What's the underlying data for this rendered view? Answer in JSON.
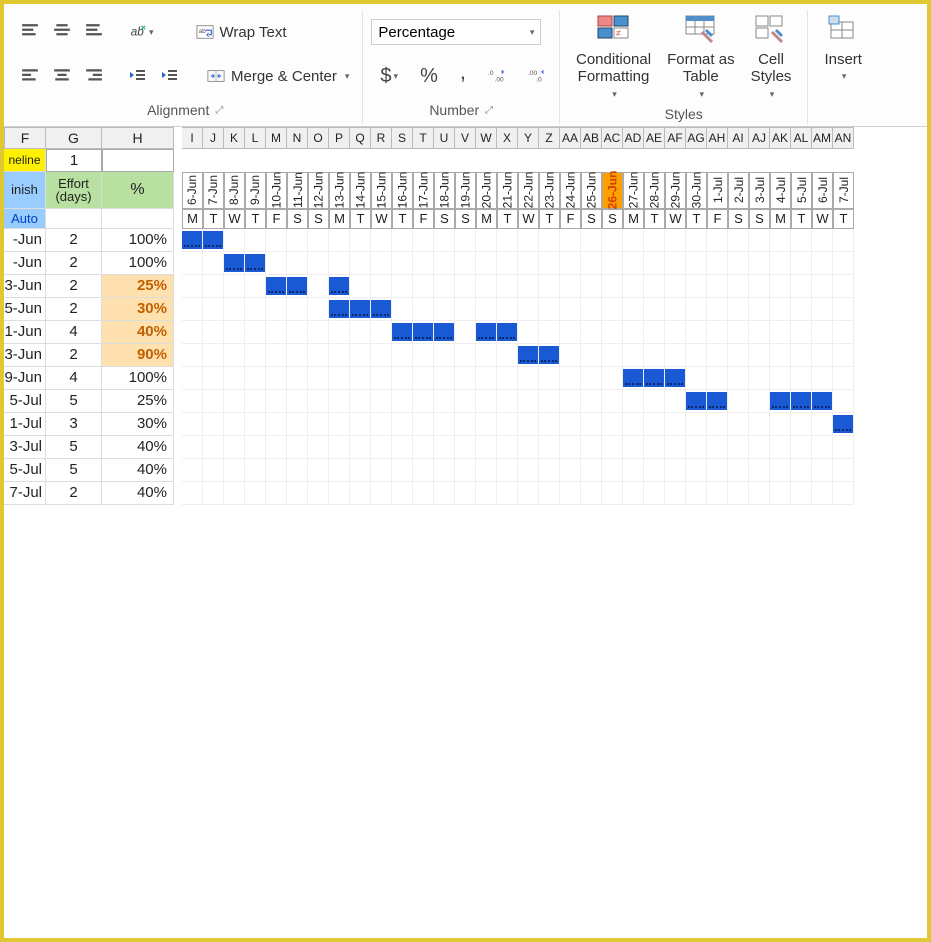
{
  "ribbon": {
    "wrap_text": "Wrap Text",
    "merge_center": "Merge & Center",
    "number_format": "Percentage",
    "cond_fmt": "Conditional\nFormatting",
    "fmt_table": "Format as\nTable",
    "cell_styles": "Cell\nStyles",
    "insert": "Insert",
    "grp_alignment": "Alignment",
    "grp_number": "Number",
    "grp_styles": "Styles"
  },
  "colheads_left": [
    "F",
    "G",
    "H"
  ],
  "colheads_narrow": [
    "I",
    "J",
    "K",
    "L",
    "M",
    "N",
    "O",
    "P",
    "Q",
    "R",
    "S",
    "T",
    "U",
    "V",
    "W",
    "X",
    "Y",
    "Z",
    "AA",
    "AB",
    "AC",
    "AD",
    "AE",
    "AF",
    "AG",
    "AH",
    "AI",
    "AJ",
    "AK",
    "AL",
    "AM",
    "AN"
  ],
  "dates": [
    "6-Jun",
    "7-Jun",
    "8-Jun",
    "9-Jun",
    "10-Jun",
    "11-Jun",
    "12-Jun",
    "13-Jun",
    "14-Jun",
    "15-Jun",
    "16-Jun",
    "17-Jun",
    "18-Jun",
    "19-Jun",
    "20-Jun",
    "21-Jun",
    "22-Jun",
    "23-Jun",
    "24-Jun",
    "25-Jun",
    "26-Jun",
    "27-Jun",
    "28-Jun",
    "29-Jun",
    "30-Jun",
    "1-Jul",
    "2-Jul",
    "3-Jul",
    "4-Jul",
    "5-Jul",
    "6-Jul",
    "7-Jul"
  ],
  "today_index": 20,
  "weekdays": [
    "M",
    "T",
    "W",
    "T",
    "F",
    "S",
    "S",
    "M",
    "T",
    "W",
    "T",
    "F",
    "S",
    "S",
    "M",
    "T",
    "W",
    "T",
    "F",
    "S",
    "S",
    "M",
    "T",
    "W",
    "T",
    "F",
    "S",
    "S",
    "M",
    "T",
    "W",
    "T"
  ],
  "hdr": {
    "timeline": "neline",
    "one": "1",
    "finish": "inish",
    "effort": "Effort (days)",
    "pct": "%",
    "auto": "Auto"
  },
  "rows": [
    {
      "f": "-Jun",
      "g": "2",
      "h": "100%",
      "h_orange": false,
      "bar_start": 0,
      "bar_len": 2
    },
    {
      "f": "-Jun",
      "g": "2",
      "h": "100%",
      "h_orange": false,
      "bar_start": 2,
      "bar_len": 2
    },
    {
      "f": "3-Jun",
      "g": "2",
      "h": "25%",
      "h_orange": true,
      "bar_start": 4,
      "bar_len": 2,
      "extra": [
        7
      ]
    },
    {
      "f": "5-Jun",
      "g": "2",
      "h": "30%",
      "h_orange": true,
      "bar_start": 7,
      "bar_len": 3
    },
    {
      "f": "1-Jun",
      "g": "4",
      "h": "40%",
      "h_orange": true,
      "bar_start": 10,
      "bar_len": 3,
      "extra": [
        14,
        15
      ]
    },
    {
      "f": "3-Jun",
      "g": "2",
      "h": "90%",
      "h_orange": true,
      "bar_start": 16,
      "bar_len": 2
    },
    {
      "f": "9-Jun",
      "g": "4",
      "h": "100%",
      "h_orange": false,
      "bar_start": 21,
      "bar_len": 3
    },
    {
      "f": "5-Jul",
      "g": "5",
      "h": "25%",
      "h_orange": false,
      "bar_start": 24,
      "bar_len": 2,
      "extra": [
        28,
        29,
        30
      ]
    },
    {
      "f": "1-Jul",
      "g": "3",
      "h": "30%",
      "h_orange": false,
      "bar_start": 31,
      "bar_len": 1
    },
    {
      "f": "3-Jul",
      "g": "5",
      "h": "40%",
      "h_orange": false
    },
    {
      "f": "5-Jul",
      "g": "5",
      "h": "40%",
      "h_orange": false
    },
    {
      "f": "7-Jul",
      "g": "2",
      "h": "40%",
      "h_orange": false
    }
  ]
}
